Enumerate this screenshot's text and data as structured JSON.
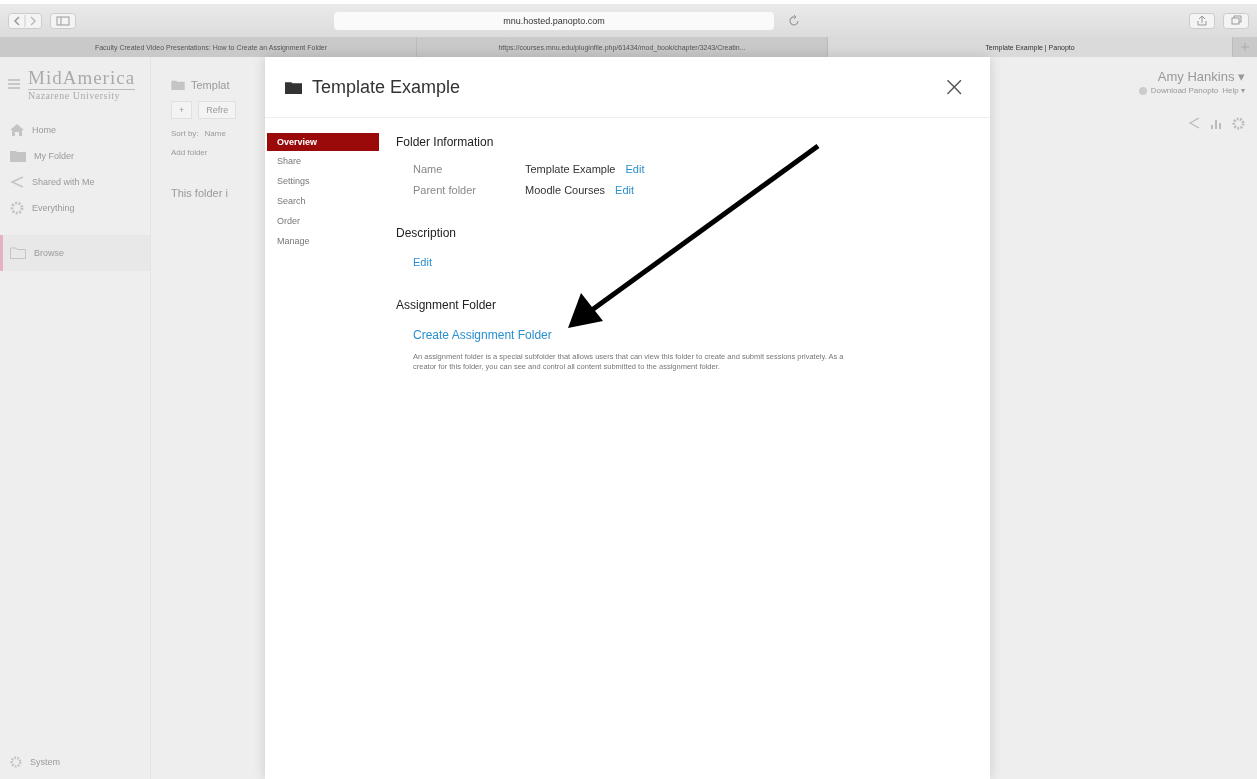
{
  "browser": {
    "address": "mnu.hosted.panopto.com",
    "tabs": [
      {
        "label": "Faculty Created Video Presentations: How to Create an Assignment Folder",
        "selected": false
      },
      {
        "label": "https://courses.mnu.edu/pluginfile.php/61434/mod_book/chapter/3243/Creatin...",
        "selected": false
      },
      {
        "label": "Template Example | Panopto",
        "selected": true
      }
    ]
  },
  "logo": {
    "line1": "MidAmerica",
    "line2": "Nazarene University"
  },
  "sidebar": {
    "items": [
      {
        "label": "Home",
        "selected": false
      },
      {
        "label": "My Folder",
        "selected": false
      },
      {
        "label": "Shared with Me",
        "selected": false
      },
      {
        "label": "Everything",
        "selected": false
      },
      {
        "label": "Browse",
        "selected": true
      }
    ],
    "footer": "System"
  },
  "folder_view": {
    "title": "Templat",
    "add": "+",
    "refresh": "Refre",
    "sort_label": "Sort by:",
    "sort_value": "Name",
    "add_folder": "Add folder",
    "empty": "This folder i"
  },
  "user": {
    "name": "Amy Hankins",
    "caret": "▾",
    "download": "Download Panopto",
    "help": "Help ▾"
  },
  "modal": {
    "title": "Template Example",
    "close": "×",
    "nav": [
      {
        "label": "Overview",
        "selected": true
      },
      {
        "label": "Share",
        "selected": false
      },
      {
        "label": "Settings",
        "selected": false
      },
      {
        "label": "Search",
        "selected": false
      },
      {
        "label": "Order",
        "selected": false
      },
      {
        "label": "Manage",
        "selected": false
      }
    ],
    "folder_information": {
      "heading": "Folder Information",
      "rows": [
        {
          "label": "Name",
          "value": "Template Example",
          "action": "Edit"
        },
        {
          "label": "Parent folder",
          "value": "Moodle Courses",
          "action": "Edit"
        }
      ]
    },
    "description": {
      "heading": "Description",
      "action": "Edit"
    },
    "assignment": {
      "heading": "Assignment Folder",
      "link": "Create Assignment Folder",
      "text": "An assignment folder is a special subfolder that allows users that can view this folder to create and submit sessions privately. As a creator for this folder, you can see and control all content submitted to the assignment folder."
    }
  }
}
